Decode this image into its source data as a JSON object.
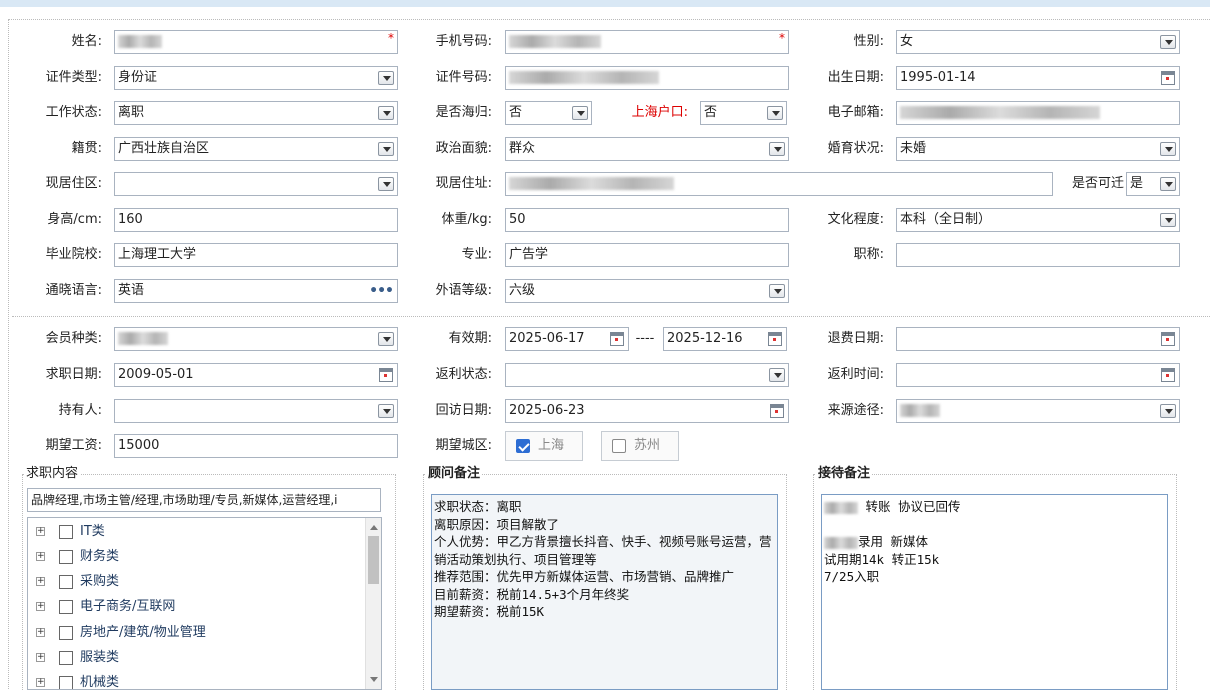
{
  "colors": {
    "label": "#222222",
    "required": "#dd0000",
    "highlight_label": "#dd0000",
    "accent": "#2d6dd3"
  },
  "form": {
    "name": {
      "label": "姓名:",
      "required": "*"
    },
    "phone": {
      "label": "手机号码:",
      "required": "*"
    },
    "gender": {
      "label": "性别:",
      "value": "女"
    },
    "id_type": {
      "label": "证件类型:",
      "value": "身份证"
    },
    "id_no": {
      "label": "证件号码:"
    },
    "birth": {
      "label": "出生日期:",
      "value": "1995-01-14"
    },
    "work_status": {
      "label": "工作状态:",
      "value": "离职"
    },
    "overseas": {
      "label": "是否海归:",
      "value": "否"
    },
    "hukou": {
      "label": "上海户口:",
      "value": "否"
    },
    "email": {
      "label": "电子邮箱:"
    },
    "native": {
      "label": "籍贯:",
      "value": "广西壮族自治区"
    },
    "political": {
      "label": "政治面貌:",
      "value": "群众"
    },
    "marital": {
      "label": "婚育状况:",
      "value": "未婚"
    },
    "residence_area": {
      "label": "现居住区:",
      "value": ""
    },
    "address": {
      "label": "现居住址:"
    },
    "relocate": {
      "label": "是否可迁",
      "value": "是"
    },
    "height": {
      "label": "身高/cm:",
      "value": "160"
    },
    "weight": {
      "label": "体重/kg:",
      "value": "50"
    },
    "education": {
      "label": "文化程度:",
      "value": "本科（全日制）"
    },
    "school": {
      "label": "毕业院校:",
      "value": "上海理工大学"
    },
    "major": {
      "label": "专业:",
      "value": "广告学"
    },
    "title": {
      "label": "职称:",
      "value": ""
    },
    "language": {
      "label": "通晓语言:",
      "value": "英语",
      "more": "•••"
    },
    "lang_level": {
      "label": "外语等级:",
      "value": "六级"
    },
    "member_type": {
      "label": "会员种类:"
    },
    "valid": {
      "label": "有效期:",
      "start": "2025-06-17",
      "sep": "----",
      "end": "2025-12-16"
    },
    "refund_date": {
      "label": "退费日期:",
      "value": ""
    },
    "job_date": {
      "label": "求职日期:",
      "value": "2009-05-01"
    },
    "rebate_status": {
      "label": "返利状态:",
      "value": ""
    },
    "rebate_time": {
      "label": "返利时间:",
      "value": ""
    },
    "holder": {
      "label": "持有人:",
      "value": ""
    },
    "visit_date": {
      "label": "回访日期:",
      "value": "2025-06-23"
    },
    "source": {
      "label": "来源途径:"
    },
    "salary": {
      "label": "期望工资:",
      "value": "15000"
    },
    "city": {
      "label": "期望城区:",
      "options": [
        {
          "label": "上海",
          "checked": true
        },
        {
          "label": "苏州",
          "checked": false
        }
      ]
    }
  },
  "job_panel": {
    "title": "求职内容",
    "selected": "品牌经理,市场主管/经理,市场助理/专员,新媒体,运营经理,i",
    "tree": [
      "IT类",
      "财务类",
      "采购类",
      "电子商务/互联网",
      "房地产/建筑/物业管理",
      "服装类",
      "机械类"
    ],
    "expand_glyph": "+"
  },
  "advisor_panel": {
    "title": "顾问备注",
    "text": "求职状态：离职\n离职原因：项目解散了\n个人优势：甲乙方背景擅长抖音、快手、视频号账号运营，营销活动策划执行、项目管理等\n推荐范围：优先甲方新媒体运营、市场营销、品牌推广\n目前薪资：税前14.5+3个月年终奖\n期望薪资：税前15K"
  },
  "reception_panel": {
    "title": "接待备注",
    "line1": " 转账 协议已回传",
    "line2": "录用 新媒体",
    "line3": "试用期14k 转正15k\n7/25入职"
  }
}
